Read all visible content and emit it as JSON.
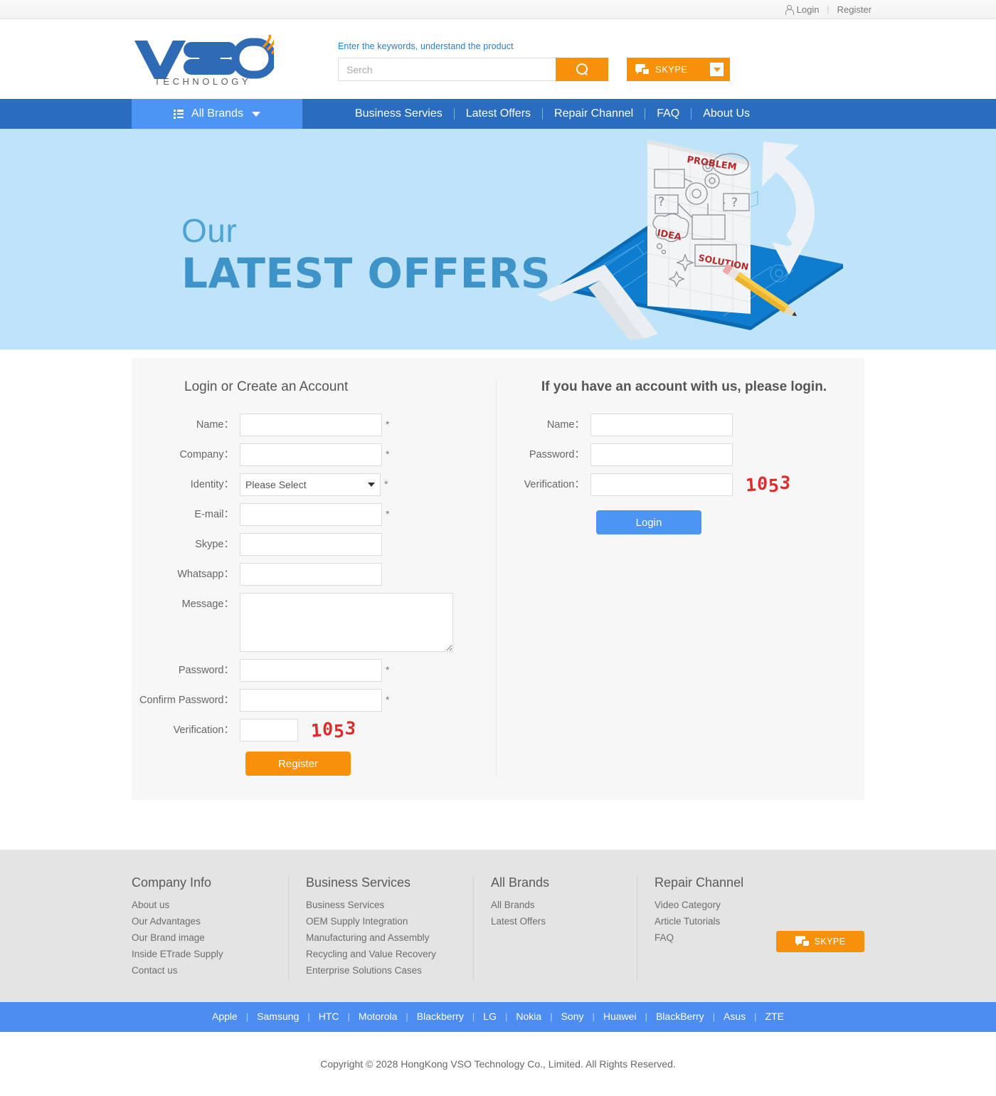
{
  "topbar": {
    "login": "Login",
    "register": "Register",
    "separator": "|"
  },
  "header": {
    "logo_text": "VSO",
    "logo_sub": "TECHNOLOGY",
    "search_tagline": "Enter the keywords, understand the product",
    "search_placeholder": "Serch",
    "search_value": "",
    "skype_label": "SKYPE"
  },
  "nav": {
    "all_brands": "All Brands",
    "links": [
      "Business Servies",
      "Latest Offers",
      "Repair Channel",
      "FAQ",
      "About Us"
    ]
  },
  "hero": {
    "eyebrow": "Our",
    "title": "LATEST OFFERS",
    "art_labels": {
      "problem": "PROBLEM",
      "idea": "IDEA",
      "solution": "SOLUTION",
      "question": "?"
    }
  },
  "register_form": {
    "title": "Login or Create an Account",
    "fields": [
      {
        "label": "Name：",
        "type": "text",
        "value": "",
        "required": "*"
      },
      {
        "label": "Company：",
        "type": "text",
        "value": "",
        "required": "*"
      },
      {
        "label": "Identity：",
        "type": "select",
        "value": "Please Select",
        "required": "*"
      },
      {
        "label": "E-mail：",
        "type": "text",
        "value": "",
        "required": "*"
      },
      {
        "label": "Skype：",
        "type": "text",
        "value": "",
        "required": ""
      },
      {
        "label": "Whatsapp：",
        "type": "text",
        "value": "",
        "required": ""
      },
      {
        "label": "Message：",
        "type": "textarea",
        "value": "",
        "required": ""
      },
      {
        "label": "Password：",
        "type": "text",
        "value": "",
        "required": "*"
      },
      {
        "label": "Confirm Password：",
        "type": "text",
        "value": "",
        "required": "*"
      },
      {
        "label": "Verification：",
        "type": "captcha",
        "value": "",
        "required": ""
      }
    ],
    "identity_selected": "Please Select",
    "captcha_code": "1053",
    "submit_label": "Register"
  },
  "login_form": {
    "title": "If you have an account with us, please login.",
    "name_label": "Name：",
    "password_label": "Password：",
    "verification_label": "Verification：",
    "name_value": "",
    "password_value": "",
    "verification_value": "",
    "captcha_code": "1053",
    "submit_label": "Login"
  },
  "footer": {
    "columns": [
      {
        "heading": "Company Info",
        "items": [
          "About us",
          "Our Advantages",
          "Our Brand image",
          "Inside ETrade Supply",
          "Contact us"
        ]
      },
      {
        "heading": "Business Services",
        "items": [
          "Business Services",
          "OEM Supply Integration",
          "Manufacturing and Assembly",
          "Recycling and Value Recovery",
          "Enterprise Solutions Cases"
        ]
      },
      {
        "heading": "All Brands",
        "items": [
          "All Brands",
          "Latest Offers"
        ]
      },
      {
        "heading": "Repair Channel",
        "items": [
          "Video Category",
          "Article Tutorials",
          "FAQ"
        ]
      }
    ],
    "skype_label": "SKYPE",
    "brands": [
      "Apple",
      "Samsung",
      "HTC",
      "Motorola",
      "Blackberry",
      "LG",
      "Nokia",
      "Sony",
      "Huawei",
      "BlackBerry",
      "Asus",
      "ZTE"
    ],
    "brand_separator": "|",
    "copyright": "Copyright © 2028 HongKong VSO Technology Co., Limited. All Rights Reserved."
  },
  "colors": {
    "nav_blue": "#2a6cbd",
    "active_blue": "#4d95f5",
    "orange": "#f7910b",
    "hero_bg": "#bfe4f9",
    "hero_title": "#3e93c9",
    "captcha_red": "#e02b2b",
    "brands_bar": "#4d8cf0"
  }
}
